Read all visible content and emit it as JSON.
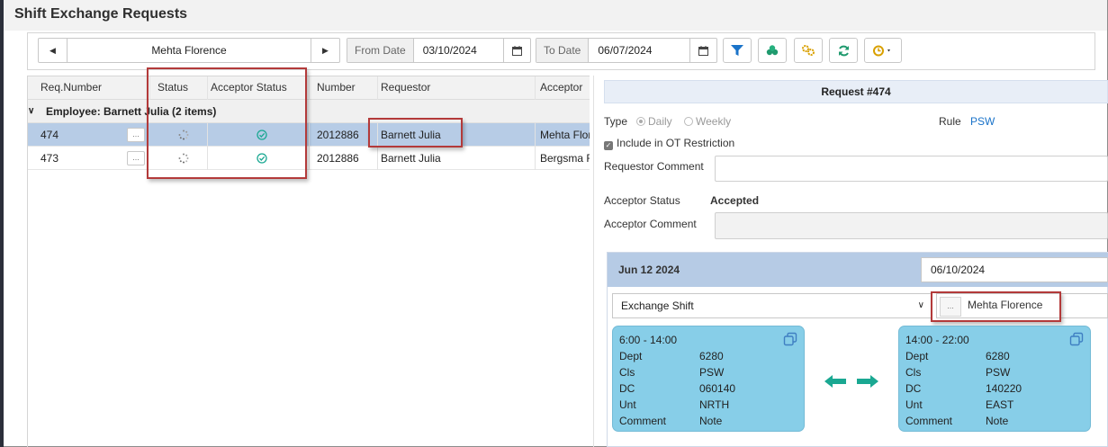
{
  "title": "Shift Exchange Requests",
  "toolbar": {
    "employee": "Mehta Florence",
    "from_label": "From Date",
    "from_value": "03/10/2024",
    "to_label": "To Date",
    "to_value": "06/07/2024"
  },
  "grid": {
    "columns": [
      "Req.Number",
      "Status",
      "Acceptor Status",
      "Number",
      "Requestor",
      "Acceptor"
    ],
    "group_label": "Employee: Barnett Julia (2 items)",
    "rows": [
      {
        "req": "474",
        "dots": "...",
        "number": "2012886",
        "requestor": "Barnett Julia",
        "acceptor": "Mehta Flor"
      },
      {
        "req": "473",
        "dots": "...",
        "number": "2012886",
        "requestor": "Barnett Julia",
        "acceptor": "Bergsma F"
      }
    ]
  },
  "detail": {
    "header": "Request #474",
    "type_label": "Type",
    "type_daily": "Daily",
    "type_weekly": "Weekly",
    "rule_label": "Rule",
    "rule_value": "PSW",
    "include_ot": "Include in OT Restriction",
    "requestor_comment_label": "Requestor Comment",
    "acceptor_status_label": "Acceptor Status",
    "acceptor_status_value": "Accepted",
    "acceptor_comment_label": "Acceptor Comment"
  },
  "exchange": {
    "date_label": "Jun 12 2024",
    "date_input": "06/10/2024",
    "type": "Exchange Shift",
    "acceptor_dots": "...",
    "acceptor": "Mehta Florence",
    "left_shift": {
      "time": "6:00 - 14:00",
      "rows": [
        {
          "label": "Dept",
          "value": "6280"
        },
        {
          "label": "Cls",
          "value": "PSW"
        },
        {
          "label": "DC",
          "value": "060140"
        },
        {
          "label": "Unt",
          "value": "NRTH"
        },
        {
          "label": "Comment",
          "value": "Note"
        }
      ]
    },
    "right_shift": {
      "time": "14:00 - 22:00",
      "rows": [
        {
          "label": "Dept",
          "value": "6280"
        },
        {
          "label": "Cls",
          "value": "PSW"
        },
        {
          "label": "DC",
          "value": "140220"
        },
        {
          "label": "Unt",
          "value": "EAST"
        },
        {
          "label": "Comment",
          "value": "Note"
        }
      ]
    }
  },
  "colors": {
    "accent": "#1a73c9",
    "selected_row": "#b7cce6",
    "shift_card": "#87cee8",
    "teal": "#1aa892",
    "highlight": "#b33a3a"
  },
  "icons": [
    "chevron-left-icon",
    "chevron-right-icon",
    "calendar-icon",
    "filter-icon",
    "group-icon",
    "settings-icon",
    "refresh-icon",
    "history-icon",
    "spinner-icon",
    "check-circle-icon",
    "copy-icon",
    "swap-arrows-icon"
  ]
}
